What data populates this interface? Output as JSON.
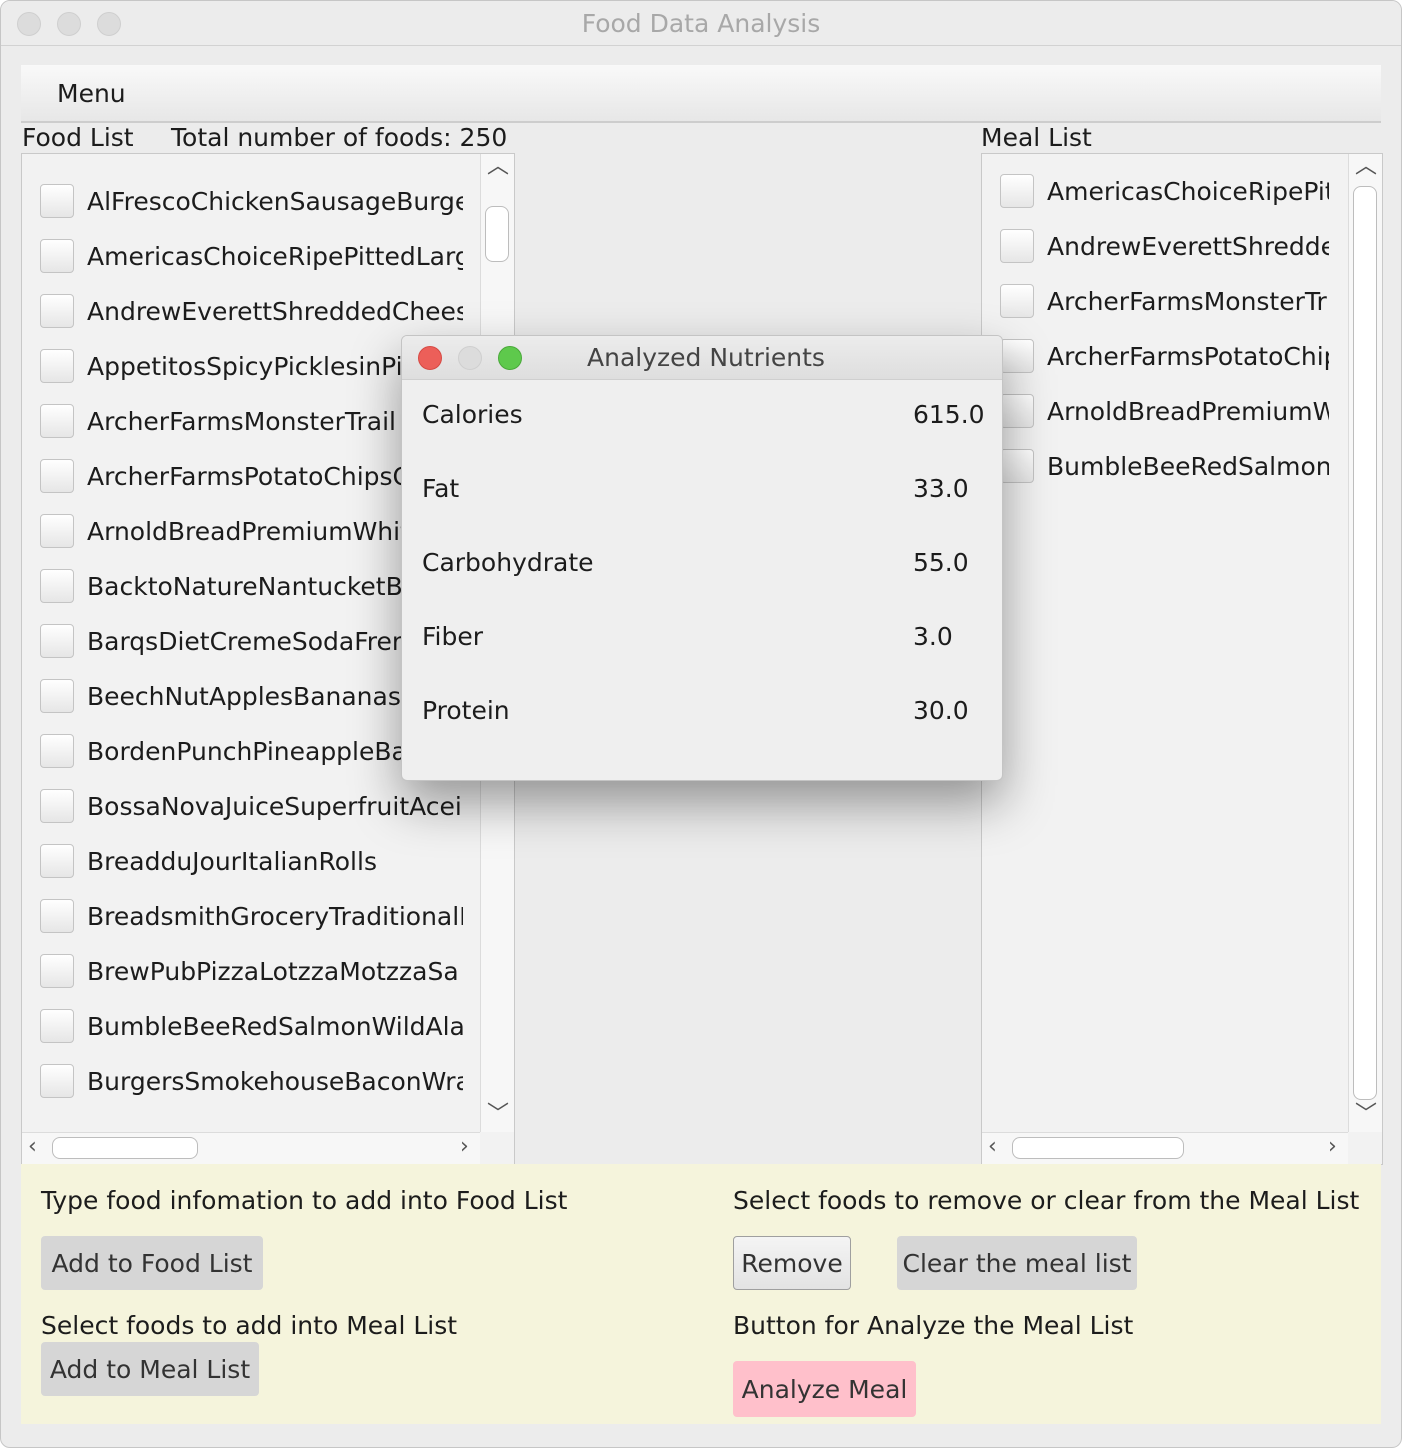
{
  "window": {
    "title": "Food Data Analysis"
  },
  "menubar": {
    "menu_label": "Menu"
  },
  "food_list": {
    "label": "Food List",
    "total_label": "Total number of foods: 250",
    "items": [
      "AlFrescoChickenSausageBurge",
      "AmericasChoiceRipePittedLarg",
      "AndrewEverettShreddedChees",
      "AppetitosSpicyPicklesinPi",
      "ArcherFarmsMonsterTrail",
      "ArcherFarmsPotatoChipsC",
      "ArnoldBreadPremiumWhit",
      "BacktoNatureNantucketBl",
      "BarqsDietCremeSodaFren",
      "BeechNutApplesBananasS",
      "BordenPunchPineappleBa",
      "BossaNovaJuiceSuperfruitAcei",
      "BreadduJourItalianRolls",
      "BreadsmithGroceryTraditionalE",
      "BrewPubPizzaLotzzaMotzzaSa",
      "BumbleBeeRedSalmonWildAlas",
      "BurgersSmokehouseBaconWra"
    ]
  },
  "meal_list": {
    "label": "Meal List",
    "items": [
      "AmericasChoiceRipePit",
      "AndrewEverettShredde",
      "ArcherFarmsMonsterTr",
      "ArcherFarmsPotatoChip",
      "ArnoldBreadPremiumW",
      "BumbleBeeRedSalmonW"
    ]
  },
  "controls": {
    "add_food_hint": "Type food infomation to add into Food List",
    "add_food_button": "Add to Food List",
    "add_meal_hint": "Select foods to add into Meal List",
    "add_meal_button": "Add to Meal List",
    "remove_hint": "Select foods to remove or clear from the Meal List",
    "remove_button": "Remove",
    "clear_button": "Clear the meal list",
    "analyze_hint": "Button for Analyze the Meal List",
    "analyze_button": "Analyze Meal"
  },
  "dialog": {
    "title": "Analyzed Nutrients",
    "nutrients": [
      {
        "name": "Calories",
        "value": "615.0"
      },
      {
        "name": "Fat",
        "value": "33.0"
      },
      {
        "name": "Carbohydrate",
        "value": "55.0"
      },
      {
        "name": "Fiber",
        "value": "3.0"
      },
      {
        "name": "Protein",
        "value": "30.0"
      }
    ]
  },
  "colors": {
    "bottom_panel": "#f5f4dc",
    "analyze_button": "#ffc0cb",
    "close_light": "#ec5f59",
    "zoom_light": "#5ec94c"
  }
}
